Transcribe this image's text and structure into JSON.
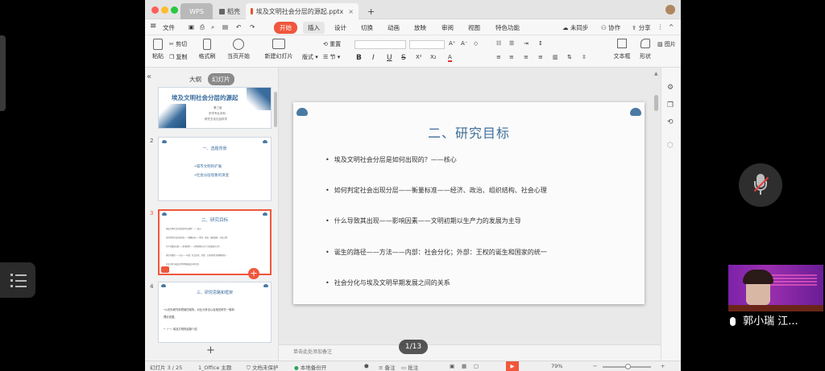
{
  "app": {
    "tabs": [
      {
        "label": "WPS"
      },
      {
        "label": "稻壳"
      },
      {
        "label": "埃及文明社会分层的源起.pptx"
      }
    ],
    "menu": [
      "文件",
      "开始",
      "插入",
      "设计",
      "切换",
      "动画",
      "放映",
      "审阅",
      "视图",
      "特色功能"
    ],
    "menu_right": {
      "sync": "未同步",
      "collab": "协作",
      "share": "分享"
    },
    "ribbon": {
      "paste": "粘贴",
      "cut": "剪切",
      "copy": "复制",
      "format_painter": "格式刷",
      "start_from_current": "当页开始",
      "new_slide": "新建幻灯片",
      "layout": "版式",
      "reset": "重置",
      "section": "节",
      "font_bold": "B",
      "font_italic": "I",
      "font_underline": "U",
      "font_strike": "S",
      "textbox": "文本框",
      "shape": "形状",
      "picture": "图片"
    }
  },
  "sidebar": {
    "tabs": {
      "outline": "大纲",
      "slides": "幻灯片"
    },
    "thumbs": [
      {
        "num": "",
        "title": "埃及文明社会分层的源起",
        "lines": [
          "第三组",
          "史学专业本科",
          "研究文化社会科学"
        ]
      },
      {
        "num": "2",
        "title": "一、选题背景",
        "lines": [
          "•城市文明的扩展",
          "•社会分层现象的演变"
        ]
      },
      {
        "num": "3",
        "title": "二、研究目标",
        "lines": [
          "埃及文明社会分层是如何出现的？——核心",
          "如何判定社会出现分层——衡量标准——经济、政治、组织结构、社会心理",
          "什么导致其出现——影响因素——文明初期以生产力的发展为主导",
          "诞生的路径——方法——内部：社会分化；外部：王权的诞生和国家的统一",
          "社会分化与埃及文明早期发展之间的关系"
        ]
      },
      {
        "num": "4",
        "title": "三、研究思路和框架",
        "lines": [
          "•以史料研究和思维的架构，对比分析法以及相关研究一般和",
          "  理论依据。",
          "•（一）埃及文明的起源介绍"
        ]
      }
    ],
    "add": "+"
  },
  "slide": {
    "title": "二、研究目标",
    "bullets": [
      "埃及文明社会分层是如何出现的？——核心",
      "如何判定社会出现分层——衡量标准——经济、政治、组织结构、社会心理",
      "什么导致其出现——影响因素——文明初期以生产力的发展为主导",
      "诞生的路径——方法——内部：社会分化；外部：王权的诞生和国家的统一",
      "社会分化与埃及文明早期发展之间的关系"
    ]
  },
  "notes_placeholder": "单击此处添加备注",
  "page_indicator": "1/13",
  "status": {
    "slide_count": "幻灯片 3 / 25",
    "theme": "1_Office 主题",
    "doc_protect": "文档未保护",
    "backup": "本地备份开",
    "notes": "备注",
    "comments": "批注",
    "zoom": "79%"
  },
  "meeting": {
    "participant_name": "郭小瑞 江...",
    "mic_state": "muted"
  },
  "colors": {
    "slide_title": "#3f6f9a",
    "accent_orange": "#f0573c",
    "thumb_blue": "#3a6d9e",
    "mic_red": "#e83d3d"
  }
}
